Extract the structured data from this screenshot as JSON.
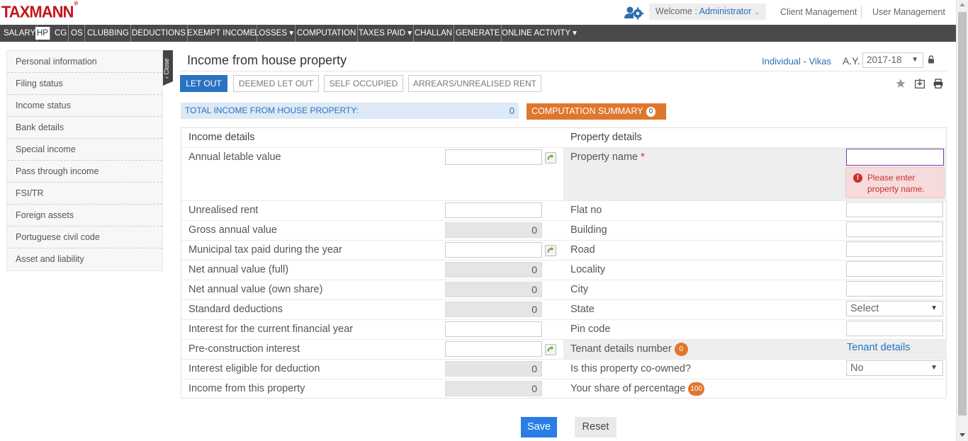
{
  "header": {
    "logo": "TAXMANN",
    "logo_mark": "®",
    "welcome_prefix": "Welcome : ",
    "welcome_user": "Administrator",
    "client_management": "Client Management",
    "user_management": "User Management"
  },
  "nav": {
    "items": [
      "SALARY",
      "HP",
      "CG",
      "OS",
      "CLUBBING",
      "DEDUCTIONS",
      "EXEMPT INCOME",
      "LOSSES ▾",
      "COMPUTATION",
      "TAXES PAID ▾",
      "CHALLAN",
      "GENERATE",
      "ONLINE ACTIVITY ▾"
    ],
    "active": "HP"
  },
  "sidebar": {
    "items": [
      "Personal information",
      "Filing status",
      "Income status",
      "Bank details",
      "Special income",
      "Pass through income",
      "FSI/TR",
      "Foreign assets",
      "Portuguese civil code",
      "Asset and liability"
    ],
    "close_label": "Close"
  },
  "page": {
    "title": "Income from house property",
    "assessee": "Individual - Vikas",
    "ay_label": "A.Y.",
    "ay_value": "2017-18",
    "tabs": [
      "LET OUT",
      "DEEMED LET OUT",
      "SELF OCCUPIED",
      "ARREARS/UNREALISED RENT"
    ],
    "active_tab": "LET OUT",
    "total_label": "TOTAL INCOME FROM HOUSE PROPERTY:",
    "total_value": "0",
    "computation_summary": "COMPUTATION SUMMARY",
    "computation_count": "0"
  },
  "income": {
    "header": "Income details",
    "rows": [
      {
        "label": "Annual letable value",
        "value": "",
        "readonly": false,
        "icon": true
      },
      {
        "label": "Unrealised rent",
        "value": "",
        "readonly": false,
        "icon": false
      },
      {
        "label": "Gross annual value",
        "value": "0",
        "readonly": true,
        "icon": false
      },
      {
        "label": "Municipal tax paid during the year",
        "value": "",
        "readonly": false,
        "icon": true
      },
      {
        "label": "Net annual value (full)",
        "value": "0",
        "readonly": true,
        "icon": false
      },
      {
        "label": "Net annual value (own share)",
        "value": "0",
        "readonly": true,
        "icon": false
      },
      {
        "label": "Standard deductions",
        "value": "0",
        "readonly": true,
        "icon": false
      },
      {
        "label": "Interest for the current financial year",
        "value": "",
        "readonly": false,
        "icon": false
      },
      {
        "label": "Pre-construction interest",
        "value": "",
        "readonly": false,
        "icon": true
      },
      {
        "label": "Interest eligible for deduction",
        "value": "0",
        "readonly": true,
        "icon": false
      },
      {
        "label": "Income from this property",
        "value": "0",
        "readonly": true,
        "icon": false
      }
    ]
  },
  "property": {
    "header": "Property details",
    "property_name_label": "Property name",
    "required_mark": "*",
    "property_name_value": "",
    "error_message": "Please enter property name.",
    "flat_no": "Flat no",
    "building": "Building",
    "road": "Road",
    "locality": "Locality",
    "city": "City",
    "state": "State",
    "state_value": "Select",
    "pin_code": "Pin code",
    "tenant_label": "Tenant details number",
    "tenant_count": "0",
    "tenant_link": "Tenant details",
    "co_owned_label": "Is this property co-owned?",
    "co_owned_value": "No",
    "share_label": "Your share of percentage",
    "share_value": "100"
  },
  "actions": {
    "save": "Save",
    "reset": "Reset"
  },
  "colors": {
    "accent": "#2a73c2",
    "orange": "#e0762d",
    "error": "#c9302c",
    "nav_bg": "#4a4a4a"
  }
}
